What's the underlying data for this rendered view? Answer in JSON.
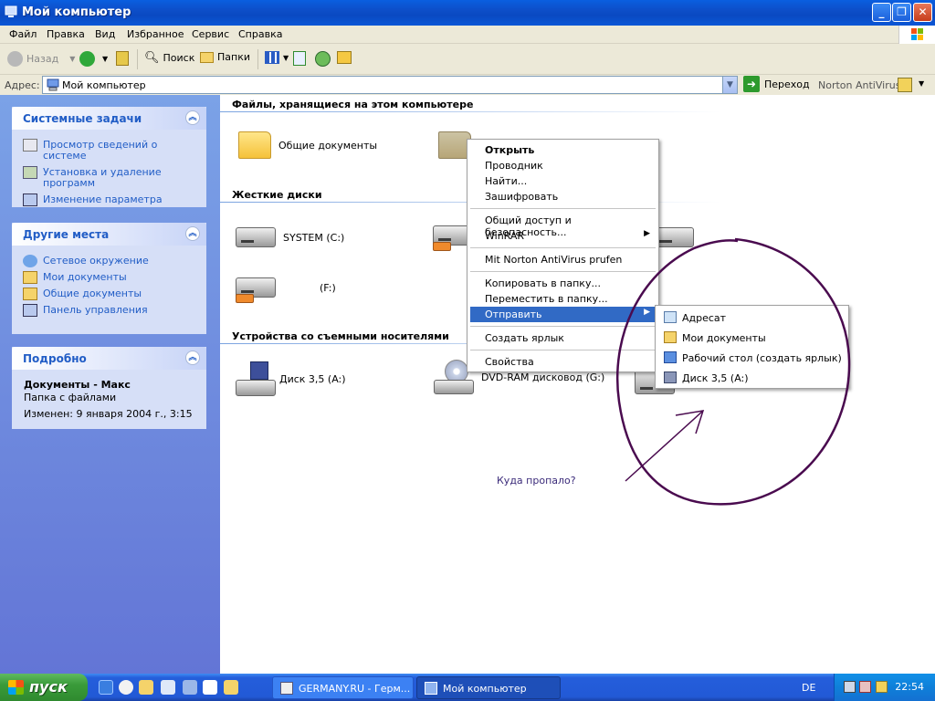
{
  "window": {
    "title": "Мой компьютер"
  },
  "menu": [
    "Файл",
    "Правка",
    "Вид",
    "Избранное",
    "Сервис",
    "Справка"
  ],
  "toolbar": {
    "back": "Назад",
    "search": "Поиск",
    "folders": "Папки"
  },
  "address": {
    "label": "Адрес:",
    "value": "Мой компьютер",
    "go": "Переход",
    "norton": "Norton AntiVirus"
  },
  "left_panel": {
    "system_tasks": {
      "title": "Системные задачи",
      "items": [
        "Просмотр сведений о системе",
        "Установка и удаление программ",
        "Изменение параметра"
      ]
    },
    "other_places": {
      "title": "Другие места",
      "items": [
        "Сетевое окружение",
        "Мои документы",
        "Общие документы",
        "Панель управления"
      ]
    },
    "details": {
      "title": "Подробно",
      "name": "Документы - Макс",
      "type": "Папка с файлами",
      "modified": "Изменен: 9 января 2004 г., 3:15"
    }
  },
  "content": {
    "groups": {
      "files": "Файлы, хранящиеся на этом компьютере",
      "hard_drives": "Жесткие диски",
      "removable": "Устройства со съемными носителями"
    },
    "items": {
      "shared_docs": "Общие документы",
      "system_c": "SYSTEM (C:)",
      "drive_f": "(F:)",
      "floppy_a": "Диск 3,5 (A:)",
      "dvd_g": "DVD-RAM дисковод (G:)"
    },
    "note": "Куда пропало?"
  },
  "context_menu": {
    "items": [
      "Открыть",
      "Проводник",
      "Найти...",
      "Зашифровать",
      "Общий доступ и безопасность...",
      "WinRAR",
      "Mit Norton AntiVirus prufen",
      "Копировать в папку...",
      "Переместить в папку...",
      "Отправить",
      "Создать ярлык",
      "Свойства"
    ]
  },
  "send_to_menu": {
    "items": [
      "Адресат",
      "Мои документы",
      "Рабочий стол (создать ярлык)",
      "Диск 3,5 (A:)"
    ]
  },
  "taskbar": {
    "start": "пуск",
    "tasks": [
      "GERMANY.RU - Герм...",
      "Мой компьютер"
    ],
    "lang": "DE",
    "time": "22:54"
  },
  "colors": {
    "xp_blue": "#245edb",
    "panel_blue": "#6375d6",
    "link": "#215dc6",
    "highlight": "#316ac5",
    "annotation": "#4a0b4f"
  }
}
